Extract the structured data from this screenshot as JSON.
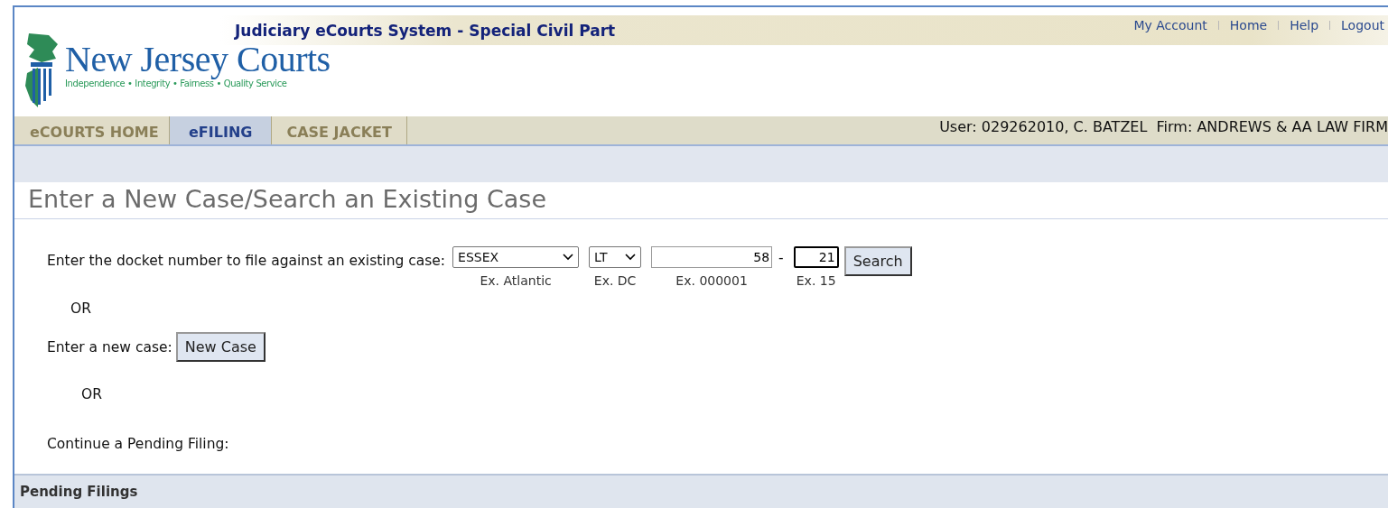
{
  "header": {
    "system_title": "Judiciary eCourts System - Special Civil Part",
    "logo_name": "New Jersey Courts",
    "tagline": "Independence • Integrity • Fairness • Quality Service",
    "top_links": [
      {
        "label": "My Account"
      },
      {
        "label": "Home"
      },
      {
        "label": "Help"
      },
      {
        "label": "Logout"
      }
    ]
  },
  "tabs": [
    {
      "label": "eCOURTS HOME",
      "selected": false
    },
    {
      "label": "eFILING",
      "selected": true
    },
    {
      "label": "CASE JACKET",
      "selected": false
    }
  ],
  "user_info": "User: 029262010, C. BATZEL  Firm: ANDREWS & AA LAW FIRM",
  "page_title": "Enter a New Case/Search an Existing Case",
  "docket": {
    "label": "Enter the docket number to file against an existing case:",
    "venue": {
      "value": "ESSEX",
      "hint": "Ex. Atlantic"
    },
    "court": {
      "value": "LT",
      "hint": "Ex. DC"
    },
    "number": {
      "value": "58",
      "hint": "Ex. 000001"
    },
    "separator": "-",
    "year": {
      "value": "21",
      "hint": "Ex. 15"
    },
    "button": "Search"
  },
  "or_1": "OR",
  "new_case": {
    "label": "Enter a new case:",
    "button": "New Case"
  },
  "or_2": "OR",
  "pending_label": "Continue a Pending Filing:",
  "pending_bar": "Pending Filings"
}
